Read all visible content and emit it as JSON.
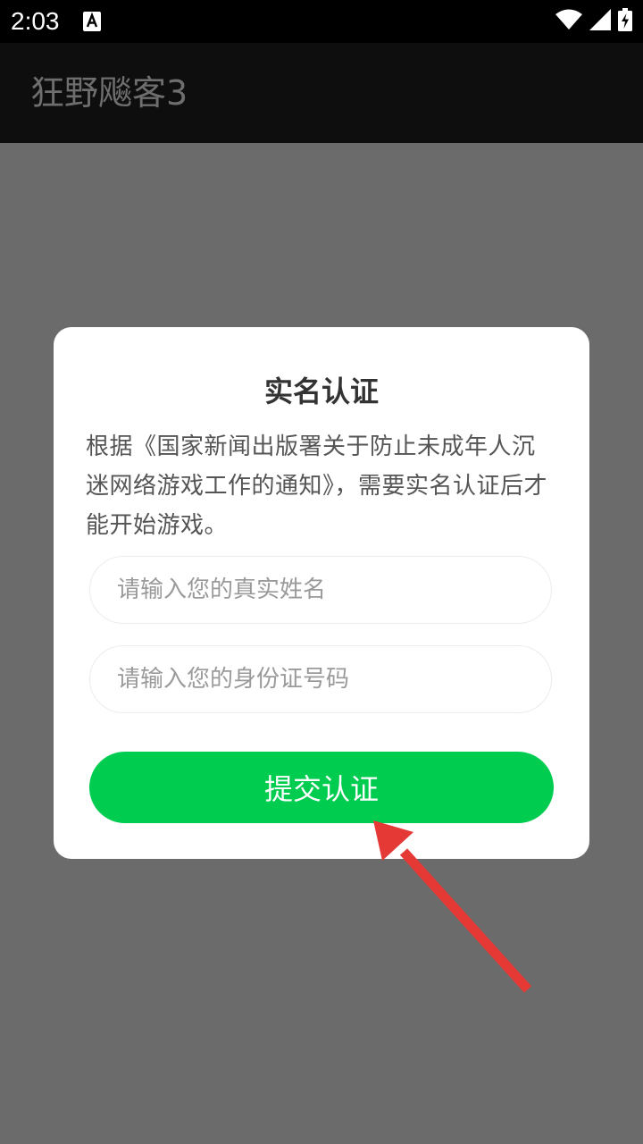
{
  "status_bar": {
    "time": "2:03",
    "notification_icon": "accessibility-notification-icon",
    "icons": [
      "wifi-icon",
      "signal-icon",
      "battery-charging-icon"
    ]
  },
  "app_bar": {
    "title": "狂野飚客3"
  },
  "dialog": {
    "title": "实名认证",
    "message": "根据《国家新闻出版署关于防止未成年人沉迷网络游戏工作的通知》，需要实名认证后才能开始游戏。",
    "name_input": {
      "placeholder": "请输入您的真实姓名",
      "value": ""
    },
    "id_input": {
      "placeholder": "请输入您的身份证号码",
      "value": ""
    },
    "submit_label": "提交认证"
  },
  "colors": {
    "overlay": "#6b6b6b",
    "app_bar": "#0e0e0e",
    "submit_button": "#00cc4f",
    "annotation_arrow": "#e53935"
  }
}
